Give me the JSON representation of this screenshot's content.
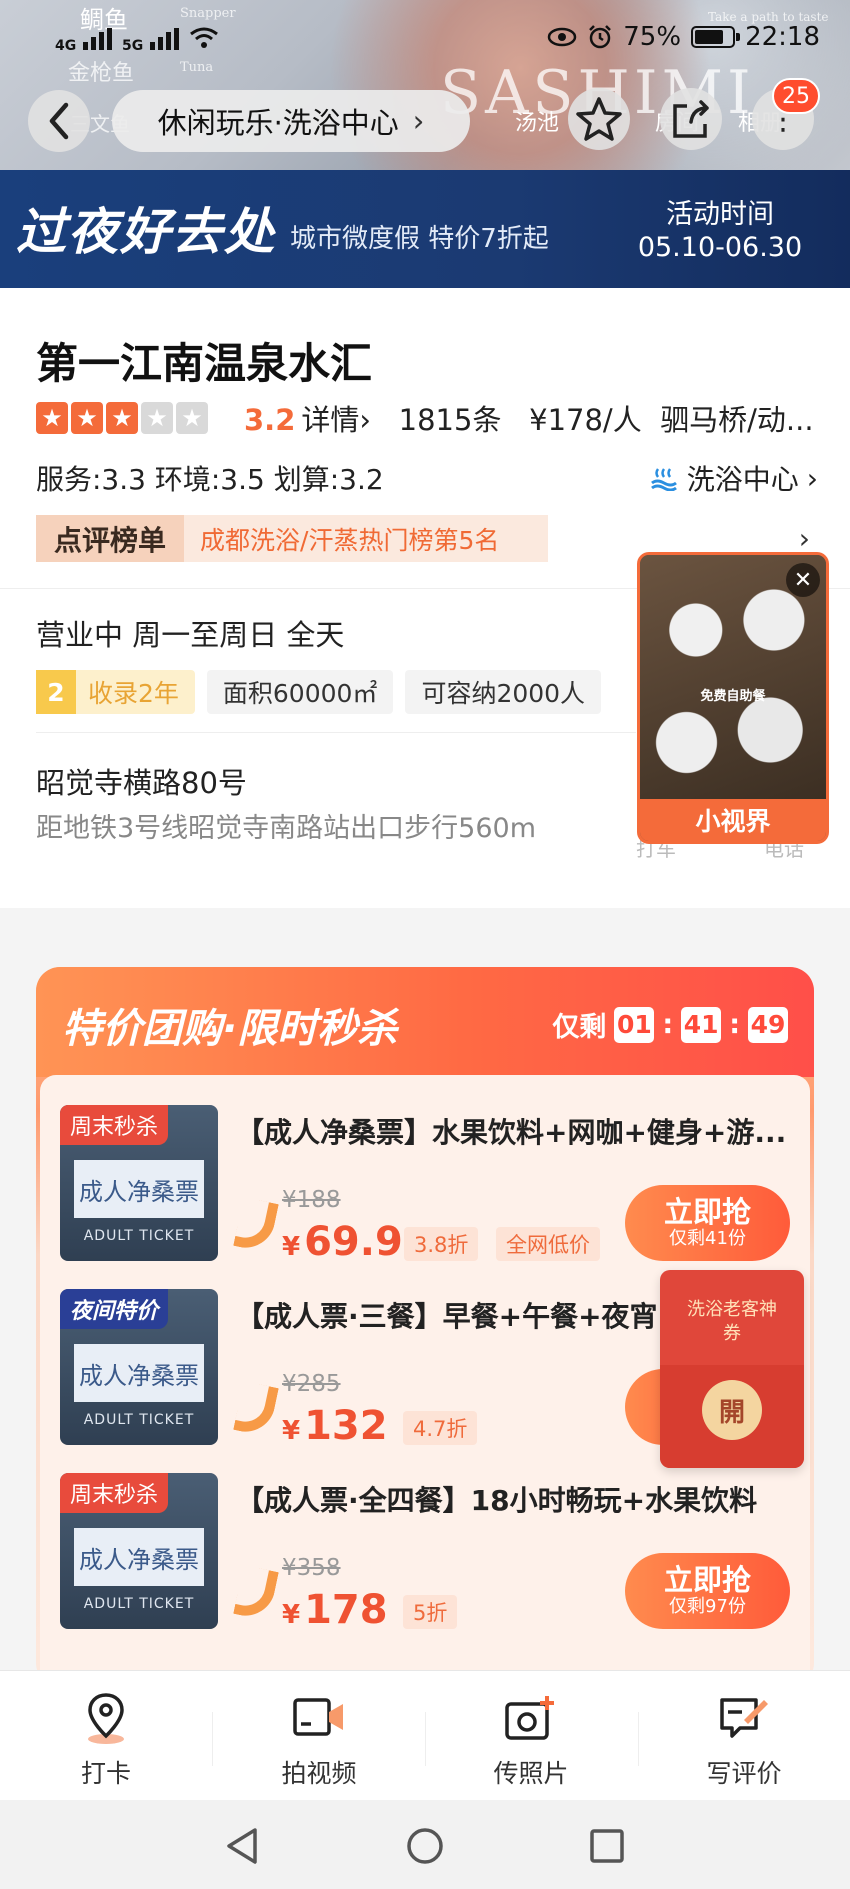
{
  "status_bar": {
    "network": "4G",
    "network2": "5G",
    "battery": "75%",
    "time": "22:18"
  },
  "hero_overlay": {
    "fish1": "鲷鱼",
    "fish1_en": "Snapper",
    "fish2": "金枪鱼",
    "fish2_en": "Tuna",
    "small_text": "Take a path to taste",
    "big_text": "SASHIMI",
    "tag_left": "三文鱼",
    "tag_mid": "汤池",
    "tag_r1": "房间",
    "tag_r2": "相册"
  },
  "nav": {
    "breadcrumb": "休闲玩乐·洗浴中心",
    "badge": "25"
  },
  "promo": {
    "title": "过夜好去处",
    "subtitle": "城市微度假 特价7折起",
    "time_label": "活动时间",
    "time_value": "05.10-06.30"
  },
  "shop": {
    "name": "第一江南温泉水汇",
    "stars": 3,
    "score": "3.2",
    "details_label": "详情",
    "reviews": "1815条",
    "price_per": "¥178/人",
    "area": "驷马桥/动...",
    "sub_scores": "服务:3.3  环境:3.5  划算:3.2",
    "category": "洗浴中心",
    "rank_label": "点评榜单",
    "rank_text": "成都洗浴/汗蒸热门榜第5名",
    "hours": "营业中  周一至周日 全天",
    "tag_years_num": "2",
    "tag_years": "收录2年",
    "tag_area": "面积60000㎡",
    "tag_capacity": "可容纳2000人",
    "address": "昭觉寺横路80号",
    "distance": "距地铁3号线昭觉寺南路站出口步行560m",
    "hint_taxi": "打车",
    "hint_phone": "电话"
  },
  "video": {
    "caption": "免费自助餐",
    "label": "小视界"
  },
  "deals": {
    "title": "特价团购·限时秒杀",
    "remain_label": "仅剩",
    "countdown": [
      "01",
      "41",
      "49"
    ],
    "items": [
      {
        "ribbon": "周末秒杀",
        "thumb_text": "成人净桑票",
        "thumb_en": "ADULT TICKET",
        "title": "【成人净桑票】水果饮料+网咖+健身+游...",
        "original_price": "¥188",
        "price_symbol": "¥",
        "price": "69.9",
        "discount": "3.8折",
        "extra_tag": "全网低价",
        "buy_label": "立即抢",
        "stock": "仅剩41份"
      },
      {
        "ribbon": "夜间特价",
        "thumb_text": "成人净桑票",
        "thumb_en": "ADULT TICKET",
        "title": "【成人票·三餐】早餐+午餐+夜宵",
        "original_price": "¥285",
        "price_symbol": "¥",
        "price": "132",
        "discount": "4.7折"
      },
      {
        "ribbon": "周末秒杀",
        "thumb_text": "成人净桑票",
        "thumb_en": "ADULT TICKET",
        "title": "【成人票·全四餐】18小时畅玩+水果饮料",
        "original_price": "¥358",
        "price_symbol": "¥",
        "price": "178",
        "discount": "5折",
        "buy_label": "立即抢",
        "stock": "仅剩97份"
      }
    ]
  },
  "coupon": {
    "title": "洗浴老客神券",
    "open": "開"
  },
  "tabbar": [
    {
      "label": "打卡",
      "icon": "location-pin-icon"
    },
    {
      "label": "拍视频",
      "icon": "video-camera-icon"
    },
    {
      "label": "传照片",
      "icon": "photo-camera-add-icon"
    },
    {
      "label": "写评价",
      "icon": "write-review-icon"
    }
  ],
  "colors": {
    "accent": "#f46b3a",
    "promo_bg": "#1a3f7c",
    "price_red": "#ef5232"
  }
}
